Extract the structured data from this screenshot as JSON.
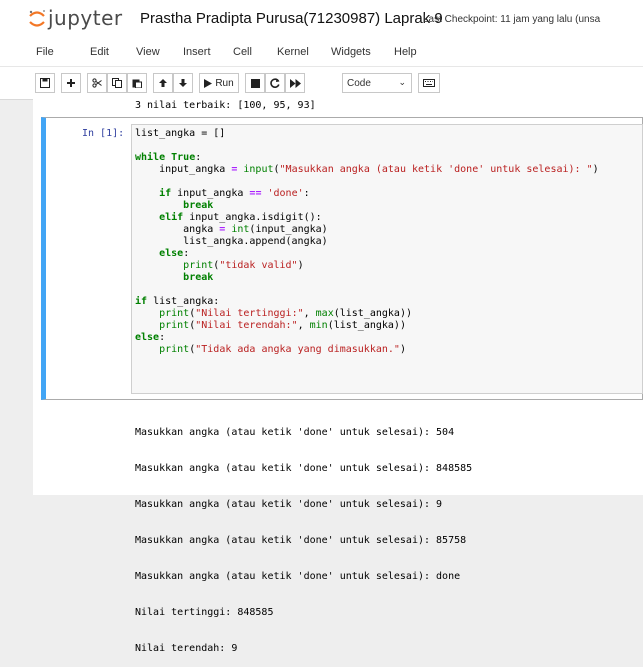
{
  "header": {
    "logo_text": "jupyter",
    "notebook_title": "Prastha Pradipta Purusa(71230987) Laprak 9",
    "checkpoint": "Last Checkpoint: 11 jam yang lalu  (unsa"
  },
  "menu": [
    "File",
    "Edit",
    "View",
    "Insert",
    "Cell",
    "Kernel",
    "Widgets",
    "Help"
  ],
  "toolbar": {
    "run_label": "Run",
    "cell_type": "Code",
    "icons": [
      "save-icon",
      "plus-icon",
      "scissors-icon",
      "copy-icon",
      "paste-icon",
      "arrow-up-icon",
      "arrow-down-icon",
      "run-icon",
      "stop-icon",
      "restart-icon",
      "fast-forward-icon",
      "keyboard-icon"
    ]
  },
  "previous_output": "3 nilai terbaik: [100, 95, 93]",
  "cell": {
    "prompt": "In [1]:",
    "code_lines": [
      "list_angka = []",
      "",
      "while True:",
      "    input_angka = input(\"Masukkan angka (atau ketik 'done' untuk selesai): \")",
      "",
      "    if input_angka == 'done':",
      "        break",
      "    elif input_angka.isdigit():",
      "        angka = int(input_angka)",
      "        list_angka.append(angka)",
      "    else:",
      "        print(\"tidak valid\")",
      "        break",
      "",
      "if list_angka:",
      "    print(\"Nilai tertinggi:\", max(list_angka))",
      "    print(\"Nilai terendah:\", min(list_angka))",
      "else:",
      "    print(\"Tidak ada angka yang dimasukkan.\")"
    ],
    "output_lines": [
      "Masukkan angka (atau ketik 'done' untuk selesai): 504",
      "Masukkan angka (atau ketik 'done' untuk selesai): 848585",
      "Masukkan angka (atau ketik 'done' untuk selesai): 9",
      "Masukkan angka (atau ketik 'done' untuk selesai): 85758",
      "Masukkan angka (atau ketik 'done' untuk selesai): done",
      "Nilai tertinggi: 848585",
      "Nilai terendah: 9"
    ]
  }
}
